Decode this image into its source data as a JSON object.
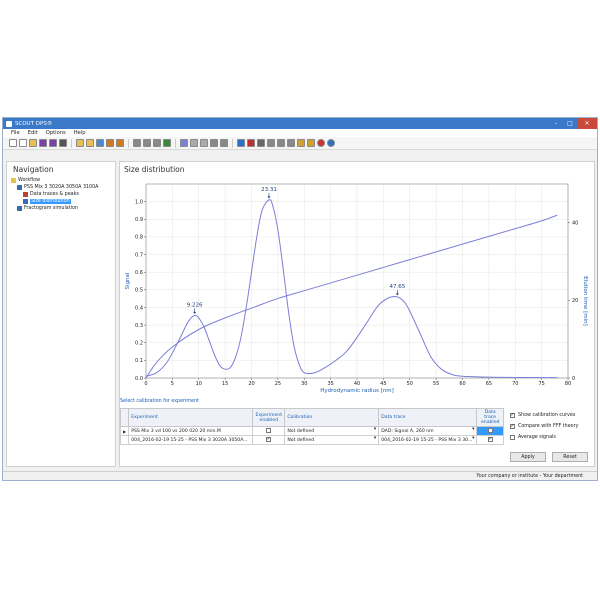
{
  "window": {
    "title": "SCOUT DPS®"
  },
  "menu": [
    "File",
    "Edit",
    "Options",
    "Help"
  ],
  "toolbar_icons": [
    "new-doc-icon",
    "new-copy-icon",
    "open-icon",
    "save-icon",
    "save-as-icon",
    "print-icon",
    "folder-icon",
    "folder-open-icon",
    "image-icon",
    "import-icon",
    "export-icon",
    "undo-icon",
    "redo-icon",
    "clock-icon",
    "percent-icon",
    "chart-icon",
    "triangle-icon",
    "mountain-icon",
    "flask-icon",
    "flask2-icon",
    "pipette-icon",
    "wand-icon",
    "cut-icon",
    "paste-icon",
    "copy-icon",
    "stack-icon",
    "ruler-icon",
    "measure-icon",
    "error-icon",
    "help-icon"
  ],
  "navigation": {
    "title": "Navigation",
    "items": [
      {
        "label": "Workflow",
        "level": 0
      },
      {
        "label": "PSS Mix 3 3020A 3050A 3100A",
        "level": 1
      },
      {
        "label": "Data traces & peaks",
        "level": 2
      },
      {
        "label": "Size distribution",
        "level": 2,
        "selected": true
      },
      {
        "label": "Fractogram simulation",
        "level": 1
      }
    ]
  },
  "main": {
    "title": "Size distribution"
  },
  "chart_data": {
    "type": "line",
    "xlabel": "Hydrodynamic radius [nm]",
    "ylabel": "Signal",
    "y2label": "Elution time [min]",
    "xlim": [
      0,
      80
    ],
    "ylim": [
      0,
      1.1
    ],
    "y2lim": [
      0,
      50
    ],
    "x_ticks": [
      0,
      5,
      10,
      15,
      20,
      25,
      30,
      35,
      40,
      45,
      50,
      55,
      60,
      65,
      70,
      75,
      80
    ],
    "y_ticks": [
      0,
      0.1,
      0.2,
      0.3,
      0.4,
      0.5,
      0.6,
      0.7,
      0.8,
      0.9,
      1.0
    ],
    "y2_ticks": [
      0,
      20,
      40
    ],
    "series": [
      {
        "axis": "left",
        "x": [
          0,
          2,
          4,
          6,
          7,
          8,
          9.226,
          10,
          11,
          12,
          13,
          14,
          15,
          16,
          17,
          18,
          19,
          20,
          21,
          22,
          23.31,
          24,
          25,
          26,
          27,
          28,
          29,
          30,
          32,
          34,
          36,
          38,
          40,
          42,
          44,
          46,
          47.65,
          49,
          50,
          52,
          54,
          56,
          58,
          60,
          65,
          70,
          75,
          78
        ],
        "y": [
          0.01,
          0.03,
          0.09,
          0.2,
          0.26,
          0.32,
          0.355,
          0.34,
          0.29,
          0.21,
          0.13,
          0.07,
          0.05,
          0.06,
          0.12,
          0.23,
          0.4,
          0.6,
          0.8,
          0.95,
          1.01,
          0.98,
          0.84,
          0.62,
          0.38,
          0.19,
          0.08,
          0.03,
          0.03,
          0.06,
          0.1,
          0.15,
          0.23,
          0.32,
          0.41,
          0.455,
          0.46,
          0.43,
          0.38,
          0.25,
          0.12,
          0.05,
          0.02,
          0.01,
          0.005,
          0.003,
          0.002,
          0.002
        ]
      },
      {
        "axis": "right",
        "x": [
          0,
          2,
          5,
          10,
          15,
          20,
          25,
          30,
          35,
          40,
          45,
          50,
          55,
          60,
          65,
          70,
          75,
          78
        ],
        "y": [
          0,
          4,
          8,
          12.5,
          15.5,
          18,
          20.5,
          22.5,
          24.5,
          26.5,
          28.5,
          30.5,
          32.5,
          34.5,
          36.5,
          38.5,
          40.5,
          42
        ]
      }
    ],
    "annotations": [
      {
        "x": 9.226,
        "y": 0.355,
        "label": "9.226"
      },
      {
        "x": 23.31,
        "y": 1.01,
        "label": "23.31"
      },
      {
        "x": 47.65,
        "y": 0.46,
        "label": "47.65"
      }
    ]
  },
  "calibration": {
    "title": "Select calibration for experiment",
    "columns": [
      "Experiment",
      "Experiment enabled",
      "Calibration",
      "Data trace",
      "Data trace enabled"
    ],
    "rows": [
      {
        "experiment": "PSS Mix 3 vd 100 vs 200 020 20 min.M",
        "experiment_enabled": false,
        "calibration": "Not defined",
        "data_trace": "DAD: Signal A, 260 nm",
        "data_trace_enabled": false,
        "current": true
      },
      {
        "experiment": "004_2016-02-19 15-25 - PSS Mix 3 3020A 3050A...",
        "experiment_enabled": true,
        "calibration": "Not defined",
        "data_trace": "004_2016-02-19 15-25 - PSS Mix 3 30...",
        "data_trace_enabled": true,
        "current": false
      }
    ]
  },
  "options": [
    {
      "label": "Show calibration curves",
      "checked": true
    },
    {
      "label": "Compare with FFF theory",
      "checked": true
    },
    {
      "label": "Average signals",
      "checked": false
    }
  ],
  "buttons": {
    "apply": "Apply",
    "reset": "Reset"
  },
  "status": "Your company or institute - Your department",
  "colors": {
    "curve": "#7b7fd6",
    "titlebar": "#3a78c8",
    "selection": "#3399ff",
    "link": "#1a5fb4"
  }
}
